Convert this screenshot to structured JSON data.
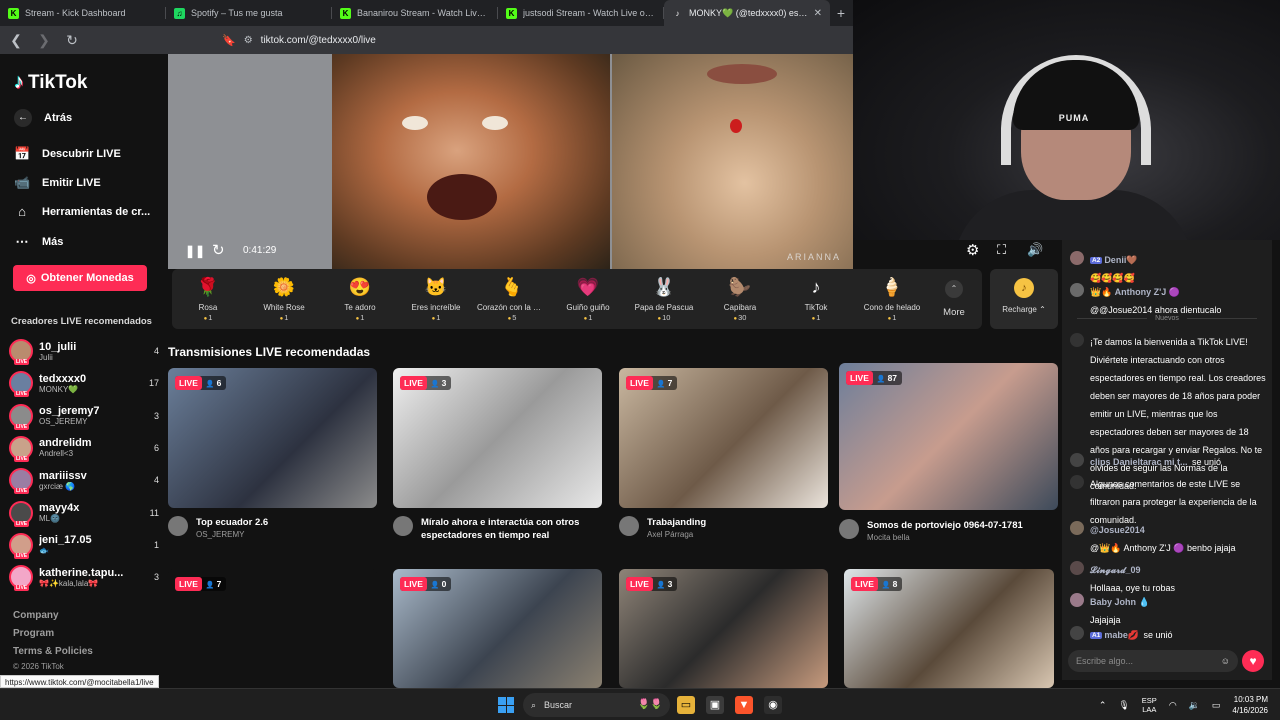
{
  "browser": {
    "tabs": [
      {
        "label": "Stream - Kick Dashboard",
        "icon_color": "#53fc18",
        "icon_glyph": "K"
      },
      {
        "label": "Spotify – Tus me gusta",
        "icon_color": "#1ed760",
        "icon_glyph": "♫"
      },
      {
        "label": "Bananirou Stream - Watch Live on Kick",
        "icon_color": "#53fc18",
        "icon_glyph": "K"
      },
      {
        "label": "justsodi Stream - Watch Live on Kick",
        "icon_color": "#53fc18",
        "icon_glyph": "K"
      },
      {
        "label": "MONKY💚 (@tedxxxx0) está en LIVE",
        "icon_color": "#ffffff",
        "icon_glyph": "♪",
        "active": true
      }
    ],
    "new_tab": "+",
    "url": "tiktok.com/@tedxxxx0/live"
  },
  "sidebar": {
    "brand": "TikTok",
    "back": "Atrás",
    "nav": [
      {
        "label": "Descubrir LIVE",
        "icon": "calendar-icon"
      },
      {
        "label": "Emitir LIVE",
        "icon": "video-icon"
      },
      {
        "label": "Herramientas de cr...",
        "icon": "home-icon"
      },
      {
        "label": "Más",
        "icon": "more-icon"
      }
    ],
    "coins_button": "Obtener Monedas",
    "creators_title": "Creadores LIVE recomendados",
    "creators": [
      {
        "name": "10_julii",
        "sub": "Julii",
        "count": "4"
      },
      {
        "name": "tedxxxx0",
        "sub": "MONKY💚",
        "count": "17"
      },
      {
        "name": "os_jeremy7",
        "sub": "OS_JEREMY",
        "count": "3"
      },
      {
        "name": "andrelidm",
        "sub": "Andrell<3",
        "count": "6"
      },
      {
        "name": "mariiissv",
        "sub": "gxrciæ 🌎",
        "count": "4"
      },
      {
        "name": "mayy4x",
        "sub": "ML🌚",
        "count": "11"
      },
      {
        "name": "jeni_17.05",
        "sub": "🐟",
        "count": "1"
      },
      {
        "name": "katherine.tapu...",
        "sub": "🎀✨kala,lala🎀",
        "count": "3"
      }
    ],
    "footer": [
      "Company",
      "Program",
      "Terms & Policies",
      "© 2026 TikTok"
    ]
  },
  "player": {
    "time": "0:41:29",
    "watermark": "ARIANNA"
  },
  "gifts": [
    {
      "name": "Rosa",
      "price": "1",
      "glyph": "🌹"
    },
    {
      "name": "White Rose",
      "price": "1",
      "glyph": "🌼"
    },
    {
      "name": "Te adoro",
      "price": "1",
      "glyph": "😍"
    },
    {
      "name": "Eres increíble",
      "price": "1",
      "glyph": "🐱"
    },
    {
      "name": "Corazón con la mano",
      "price": "5",
      "glyph": "🫰"
    },
    {
      "name": "Guiño guiño",
      "price": "1",
      "glyph": "💗"
    },
    {
      "name": "Papa de Pascua",
      "price": "10",
      "glyph": "🐰"
    },
    {
      "name": "Capibara",
      "price": "30",
      "glyph": "🦫"
    },
    {
      "name": "TikTok",
      "price": "1",
      "glyph": "♪"
    },
    {
      "name": "Cono de helado",
      "price": "1",
      "glyph": "🍦"
    }
  ],
  "more": "More",
  "recharge": "Recharge ⌃",
  "recommended": {
    "title": "Transmisiones LIVE recomendadas",
    "live_label": "LIVE",
    "cards": [
      {
        "viewers": "6",
        "title": "Top ecuador 2.6",
        "user": "OS_JEREMY",
        "bg": "linear-gradient(135deg,#6b7f9a,#2d3240 60%,#8b8b8b)"
      },
      {
        "viewers": "3",
        "title": "Míralo ahora e interactúa con otros espectadores en tiempo real",
        "user": "",
        "bg": "linear-gradient(135deg,#f0f0f0,#9a9a9a 50%,#e8e8e8)"
      },
      {
        "viewers": "7",
        "title": "Trabajanding",
        "user": "Axel Párraga",
        "bg": "linear-gradient(135deg,#c9b7a0,#6e5a48 55%,#ebe4dc)"
      },
      {
        "viewers": "87",
        "title": "Somos de portoviejo 0964-07-1781",
        "user": "Mocita bella",
        "bg": "linear-gradient(135deg,#6d7e9a,#c79c8e 50%,#3d4a5a)"
      },
      {
        "viewers": "7",
        "title": "",
        "user": "",
        "bg": "#121212"
      },
      {
        "viewers": "0",
        "title": "",
        "user": "",
        "bg": "linear-gradient(135deg,#a9b9c9,#3c4450 55%,#8a8070)"
      },
      {
        "viewers": "3",
        "title": "",
        "user": "",
        "bg": "linear-gradient(135deg,#8f8478,#2b2b2b 50%,#c69a7d)"
      },
      {
        "viewers": "8",
        "title": "",
        "user": "",
        "bg": "linear-gradient(135deg,#dfe6ea,#5a4a3a 55%,#d8c6b1)"
      }
    ]
  },
  "chat": {
    "messages": [
      {
        "user": "Denii🤎",
        "level": "A2",
        "text": "🥰🥰🥰🥰"
      },
      {
        "user": "👑🔥 Anthony Z'J 🟣",
        "level": "",
        "text": "@@Josue2014 ahora dientucalo"
      },
      {
        "user": "",
        "level": "",
        "text": "¡Te damos la bienvenida a TikTok LIVE! Diviértete interactuando con otros espectadores en tiempo real. Los creadores deben ser mayores de 18 años para poder emitir un LIVE, mientras que los espectadores deben ser mayores de 18 años para recargar y enviar Regalos. No te olvides de seguir las Normas de la comunidad."
      },
      {
        "user": "clips Danieltarac mi t...",
        "level": "",
        "text": "se unió"
      },
      {
        "user": "",
        "level": "",
        "text": "Algunos comentarios de este LIVE se filtraron para proteger la experiencia de la comunidad."
      },
      {
        "user": "@Josue2014",
        "level": "",
        "text": "@👑🔥 Anthony Z'J 🟣 benbo jajaja"
      },
      {
        "user": "𝓛𝓲𝓷𝓰𝓪𝓻𝓭_09",
        "level": "",
        "text": "Hollaaa, oye tu robas"
      },
      {
        "user": "Baby John 💧",
        "level": "",
        "text": "Jajajaja"
      },
      {
        "user": "mabe💋",
        "level": "A1",
        "text": "se unió"
      }
    ],
    "nuevos": "Nuevos",
    "input_placeholder": "Escribe algo..."
  },
  "status_url": "https://www.tiktok.com/@mocitabella1/live",
  "taskbar": {
    "search": "Buscar",
    "lang": "ESP",
    "region": "LAA",
    "time": "10:03 PM",
    "date": "4/16/2026"
  },
  "webcam": {
    "cap_brand": "PUMA"
  }
}
